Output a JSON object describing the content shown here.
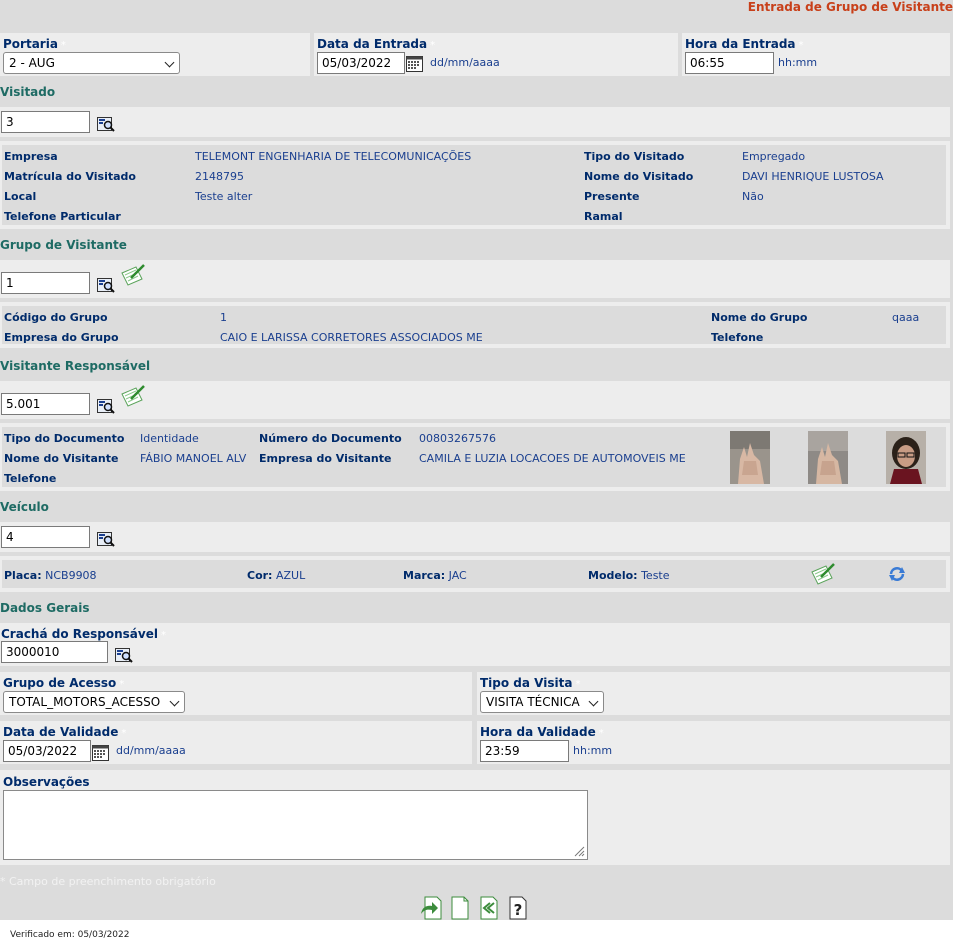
{
  "page": {
    "title": "Entrada de Grupo de Visitante"
  },
  "entry": {
    "portaria_label": "Portaria",
    "portaria_value": "2 - AUG",
    "data_label": "Data da Entrada",
    "data_value": "05/03/2022",
    "data_hint": "dd/mm/aaaa",
    "hora_label": "Hora da Entrada",
    "hora_value": "06:55",
    "hora_hint": "hh:mm",
    "required_mark": "*"
  },
  "visitado": {
    "section": "Visitado",
    "input_value": "3",
    "fields": {
      "empresa_label": "Empresa",
      "empresa_value": "TELEMONT ENGENHARIA DE TELECOMUNICAÇÕES",
      "matricula_label": "Matrícula do Visitado",
      "matricula_value": "2148795",
      "local_label": "Local",
      "local_value": "Teste alter",
      "telefone_label": "Telefone Particular",
      "telefone_value": "",
      "tipo_label": "Tipo do Visitado",
      "tipo_value": "Empregado",
      "nome_label": "Nome do Visitado",
      "nome_value": "DAVI HENRIQUE LUSTOSA",
      "presente_label": "Presente",
      "presente_value": "Não",
      "ramal_label": "Ramal",
      "ramal_value": ""
    }
  },
  "grupo": {
    "section": "Grupo de Visitante",
    "input_value": "1",
    "fields": {
      "codigo_label": "Código do Grupo",
      "codigo_value": "1",
      "empresa_label": "Empresa do Grupo",
      "empresa_value": "CAIO E LARISSA CORRETORES ASSOCIADOS ME",
      "nome_label": "Nome do Grupo",
      "nome_value": "qaaa",
      "telefone_label": "Telefone",
      "telefone_value": ""
    }
  },
  "responsavel": {
    "section": "Visitante Responsável",
    "input_value": "5.001",
    "fields": {
      "tipo_doc_label": "Tipo do Documento",
      "tipo_doc_value": "Identidade",
      "nome_label": "Nome do Visitante",
      "nome_value": "FÁBIO MANOEL ALV",
      "telefone_label": "Telefone",
      "telefone_value": "",
      "num_doc_label": "Número do Documento",
      "num_doc_value": "00803267576",
      "empresa_label": "Empresa do Visitante",
      "empresa_value": "CAMILA E LUZIA LOCACOES DE AUTOMOVEIS ME"
    }
  },
  "veiculo": {
    "section": "Veículo",
    "input_value": "4",
    "placa_label": "Placa:",
    "placa_value": "NCB9908",
    "cor_label": "Cor:",
    "cor_value": "AZUL",
    "marca_label": "Marca:",
    "marca_value": "JAC",
    "modelo_label": "Modelo:",
    "modelo_value": "Teste"
  },
  "gerais": {
    "section": "Dados Gerais",
    "cracha_label": "Crachá do Responsável",
    "cracha_value": "3000010",
    "grupo_acesso_label": "Grupo de Acesso",
    "grupo_acesso_value": "TOTAL_MOTORS_ACESSO",
    "tipo_visita_label": "Tipo da Visita",
    "tipo_visita_value": "VISITA TÉCNICA",
    "data_validade_label": "Data de Validade",
    "data_validade_value": "05/03/2022",
    "data_validade_hint": "dd/mm/aaaa",
    "hora_validade_label": "Hora da Validade",
    "hora_validade_value": "23:59",
    "hora_validade_hint": "hh:mm",
    "observacoes_label": "Observações",
    "observacoes_value": ""
  },
  "footer": {
    "required_note": "* Campo de preenchimento obrigatório",
    "verified": "Verificado em: 05/03/2022"
  },
  "icons": {
    "search": "search-user-icon",
    "edit": "edit-pencil-icon",
    "refresh": "refresh-icon",
    "calendar": "calendar-icon",
    "confirm": "confirm-document-icon",
    "new": "new-document-icon",
    "back": "back-document-icon",
    "help": "help-document-icon"
  },
  "colors": {
    "background": "#dcdcdc",
    "panel": "#ededed",
    "title": "#c8401a",
    "section": "#1e6b64",
    "label": "#002b6b",
    "value": "#1a3f8f"
  }
}
